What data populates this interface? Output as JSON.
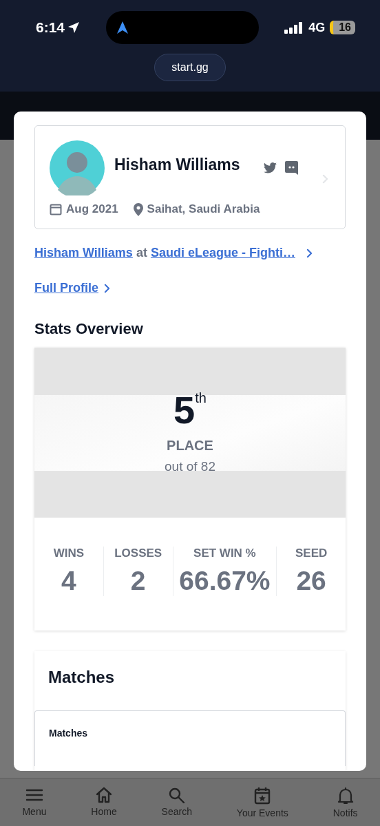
{
  "status_bar": {
    "time": "6:14",
    "network": "4G",
    "battery": "16"
  },
  "browser": {
    "url": "start.gg"
  },
  "profile": {
    "name": "Hisham Williams",
    "joined": "Aug 2021",
    "location": "Saihat, Saudi Arabia"
  },
  "event_link": {
    "player": "Hisham Williams",
    "connector": "at",
    "event": "Saudi eLeague - Fighti…"
  },
  "full_profile_link": "Full Profile",
  "stats": {
    "title": "Stats Overview",
    "placement": "5$^{th}$",
    "placement_label": "PLACE",
    "out_of": "out of 82",
    "items": [
      {
        "label": "WINS",
        "value": "4"
      },
      {
        "label": "LOSSES",
        "value": "2"
      },
      {
        "label": "SET WIN %",
        "value": "66.67%"
      },
      {
        "label": "SEED",
        "value": "26"
      }
    ]
  },
  "matches": {
    "title": "Matches",
    "subtitle": "Matches"
  },
  "bottom_nav": [
    {
      "kind": "menu",
      "label": "Menu"
    },
    {
      "kind": "home",
      "label": "Home"
    },
    {
      "kind": "search",
      "label": "Search"
    },
    {
      "kind": "events",
      "label": "Your Events"
    },
    {
      "kind": "notifs",
      "label": "Notifs"
    }
  ]
}
